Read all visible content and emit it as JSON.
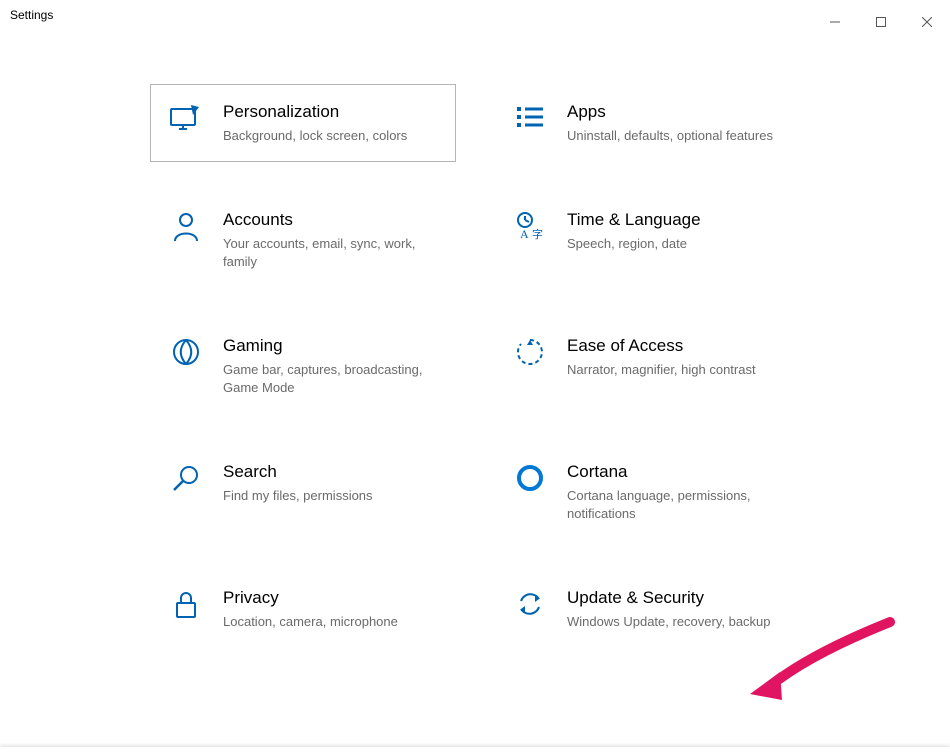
{
  "window": {
    "title": "Settings"
  },
  "tiles": {
    "personalization": {
      "title": "Personalization",
      "desc": "Background, lock screen, colors"
    },
    "apps": {
      "title": "Apps",
      "desc": "Uninstall, defaults, optional features"
    },
    "accounts": {
      "title": "Accounts",
      "desc": "Your accounts, email, sync, work, family"
    },
    "time": {
      "title": "Time & Language",
      "desc": "Speech, region, date"
    },
    "gaming": {
      "title": "Gaming",
      "desc": "Game bar, captures, broadcasting, Game Mode"
    },
    "ease": {
      "title": "Ease of Access",
      "desc": "Narrator, magnifier, high contrast"
    },
    "search": {
      "title": "Search",
      "desc": "Find my files, permissions"
    },
    "cortana": {
      "title": "Cortana",
      "desc": "Cortana language, permissions, notifications"
    },
    "privacy": {
      "title": "Privacy",
      "desc": "Location, camera, microphone"
    },
    "update": {
      "title": "Update & Security",
      "desc": "Windows Update, recovery, backup"
    }
  },
  "colors": {
    "accent": "#0063b1",
    "arrow": "#e91e63"
  }
}
